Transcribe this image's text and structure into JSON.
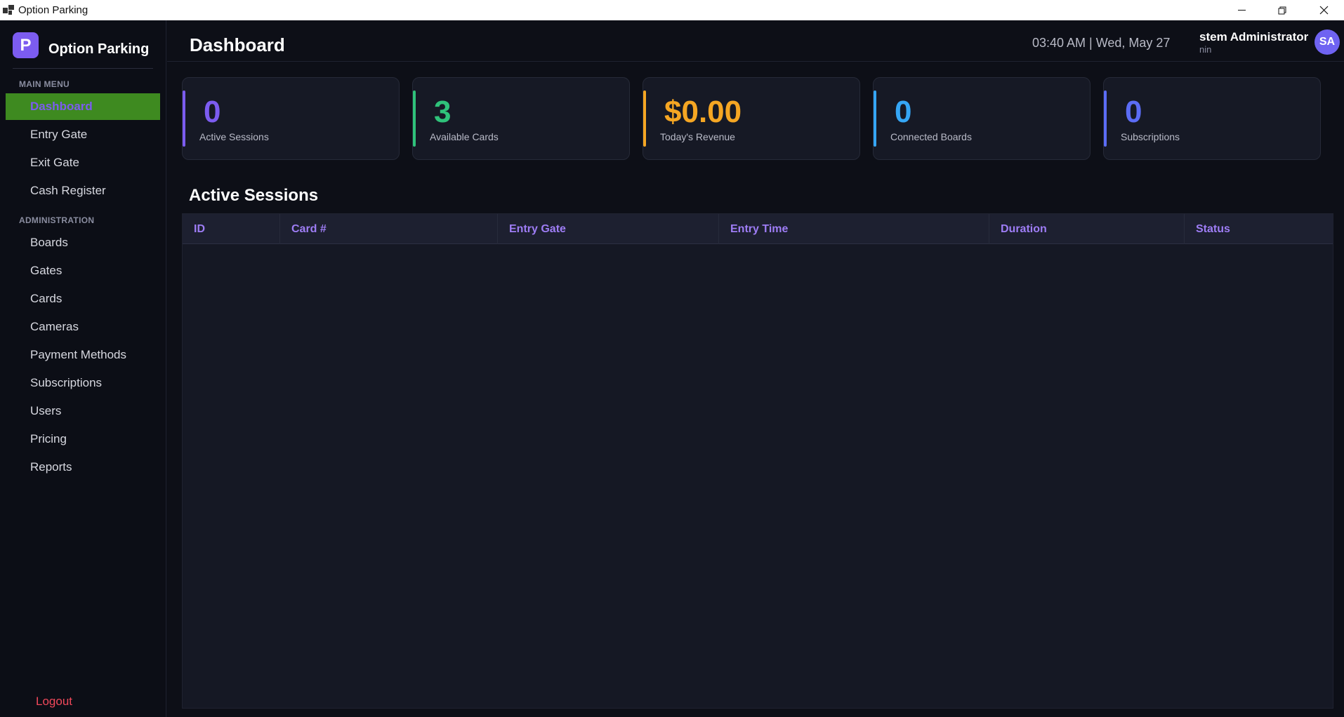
{
  "window": {
    "title": "Option Parking"
  },
  "brand": {
    "logo_letter": "P",
    "name": "Option Parking"
  },
  "sidebar": {
    "main_menu_label": "MAIN MENU",
    "main_items": [
      {
        "label": "Dashboard",
        "active": true
      },
      {
        "label": "Entry Gate"
      },
      {
        "label": "Exit Gate"
      },
      {
        "label": "Cash Register"
      }
    ],
    "admin_label": "ADMINISTRATION",
    "admin_items": [
      {
        "label": "Boards"
      },
      {
        "label": "Gates"
      },
      {
        "label": "Cards"
      },
      {
        "label": "Cameras"
      },
      {
        "label": "Payment Methods"
      },
      {
        "label": "Subscriptions"
      },
      {
        "label": "Users"
      },
      {
        "label": "Pricing"
      },
      {
        "label": "Reports"
      }
    ],
    "logout_label": "Logout"
  },
  "header": {
    "title": "Dashboard",
    "clock": "03:40 AM  |  Wed, May 27",
    "user_name": "stem Administrator",
    "user_role": "nin",
    "avatar_initials": "SA"
  },
  "stats": [
    {
      "value": "0",
      "label": "Active Sessions",
      "color": "#7c5cf0"
    },
    {
      "value": "3",
      "label": "Available Cards",
      "color": "#2fc27a"
    },
    {
      "value": "$0.00",
      "label": "Today's Revenue",
      "color": "#f5a623"
    },
    {
      "value": "0",
      "label": "Connected Boards",
      "color": "#35a6f5"
    },
    {
      "value": "0",
      "label": "Subscriptions",
      "color": "#5b6cf5"
    }
  ],
  "sessions": {
    "title": "Active Sessions",
    "columns": [
      "ID",
      "Card #",
      "Entry Gate",
      "Entry Time",
      "Duration",
      "Status"
    ],
    "rows": []
  },
  "icons": {
    "app": "app-window-icon",
    "minimize": "minimize-icon",
    "maximize": "restore-icon",
    "close": "close-icon"
  }
}
